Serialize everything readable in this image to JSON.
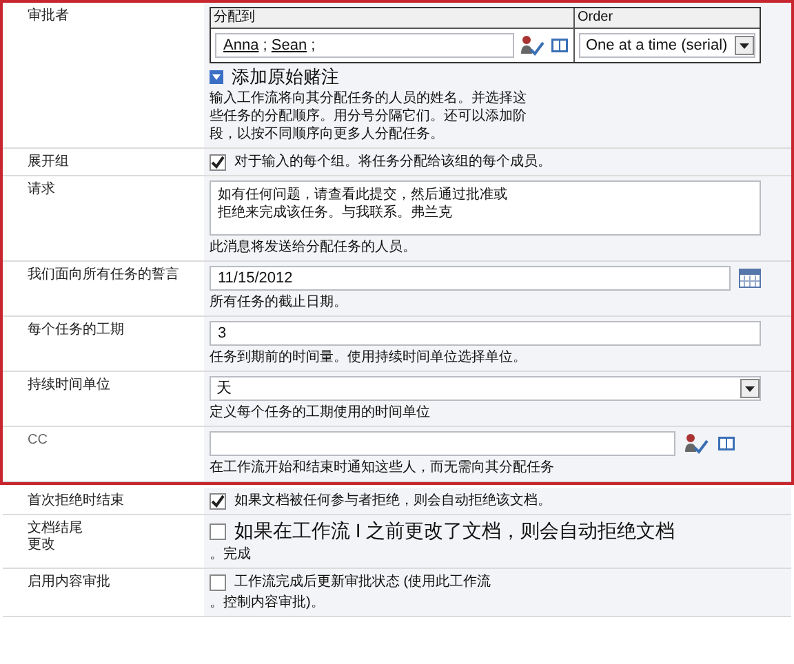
{
  "sections": [
    {
      "highlighted": true,
      "rows": [
        {
          "kind": "approvers",
          "label": "审批者",
          "assign_header": "分配到",
          "order_header": "Order",
          "people": [
            "Anna",
            "Sean"
          ],
          "separator": ";",
          "order": "One at a time (serial)",
          "add_link": "添加原始赌注",
          "hint": "输入工作流将向其分配任务的人员的姓名。并选择这些任务的分配顺序。用分号分隔它们。还可以添加阶段，以按不同顺序向更多人分配任务。"
        },
        {
          "kind": "checkbox",
          "label": "展开组",
          "checked": true,
          "lines": [
            "对于输入的每个组。将任务分配给该组的每个成员。"
          ]
        },
        {
          "kind": "textarea",
          "label": "请求",
          "lines": [
            "如有任何问题，请查看此提交，然后通过批准或",
            "拒绝来完成该任务。与我联系。弗兰克"
          ],
          "hint": "此消息将发送给分配任务的人员。"
        },
        {
          "kind": "date",
          "label": "我们面向所有任务的誓言",
          "value": "11/15/2012",
          "hint": "所有任务的截止日期。"
        },
        {
          "kind": "text",
          "label": "每个任务的工期",
          "value": "3",
          "hint": "任务到期前的时间量。使用持续时间单位选择单位。"
        },
        {
          "kind": "select",
          "label": "持续时间单位",
          "value": "天",
          "hint": "定义每个任务的工期使用的时间单位"
        },
        {
          "kind": "people",
          "label": "CC",
          "hint": "在工作流开始和结束时通知这些人，而无需向其分配任务"
        }
      ]
    },
    {
      "highlighted": false,
      "rows": [
        {
          "kind": "checkbox",
          "label": "首次拒绝时结束",
          "checked": true,
          "lines": [
            "如果文档被任何参与者拒绝，则会自动拒绝该文档。"
          ]
        },
        {
          "kind": "checkbox",
          "label": "文档结尾更改",
          "checked": false,
          "large": true,
          "lines": [
            "如果在工作流 I 之前更改了文档，则会自动拒绝文档",
            "。完成"
          ]
        },
        {
          "kind": "checkbox",
          "label": "启用内容审批",
          "checked": false,
          "lines": [
            "工作流完成后更新审批状态 (使用此工作流",
            "。控制内容审批)。"
          ]
        }
      ]
    }
  ]
}
